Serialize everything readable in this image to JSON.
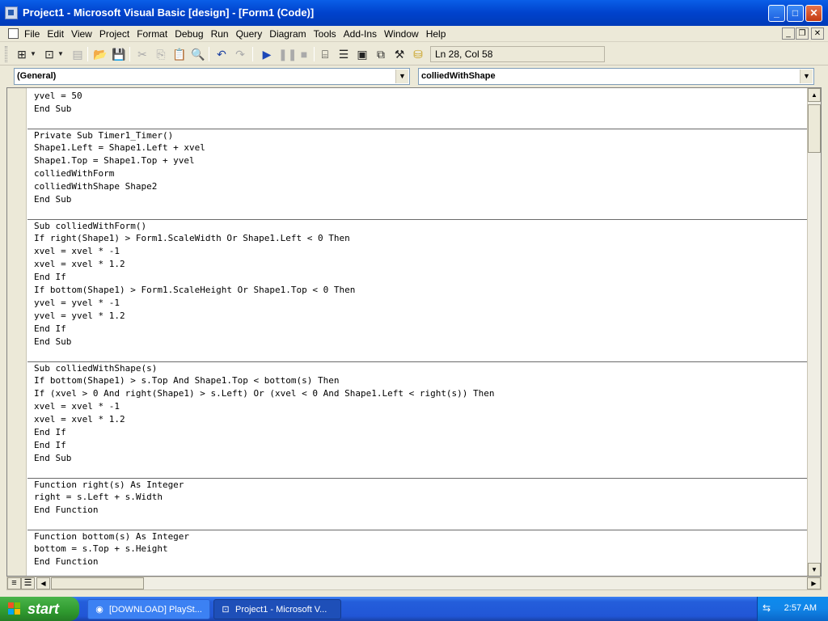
{
  "window": {
    "title": "Project1 - Microsoft Visual Basic [design] - [Form1 (Code)]",
    "buttons": {
      "minimize": "_",
      "maximize": "□",
      "close": "✕"
    }
  },
  "menu": [
    "File",
    "Edit",
    "View",
    "Project",
    "Format",
    "Debug",
    "Run",
    "Query",
    "Diagram",
    "Tools",
    "Add-Ins",
    "Window",
    "Help"
  ],
  "toolbar": {
    "position": "Ln 28, Col 58",
    "icons": [
      "add-project-icon",
      "add-form-icon",
      "menu-editor-icon",
      "open-icon",
      "save-icon",
      "cut-icon",
      "copy-icon",
      "paste-icon",
      "find-icon",
      "undo-icon",
      "redo-icon",
      "start-icon",
      "break-icon",
      "end-icon",
      "project-explorer-icon",
      "properties-icon",
      "form-layout-icon",
      "object-browser-icon",
      "toolbox-icon",
      "data-view-icon"
    ]
  },
  "combos": {
    "object": "(General)",
    "procedure": "colliedWithShape"
  },
  "code": [
    {
      "text": "yvel = 50",
      "sep": false
    },
    {
      "text": "End Sub",
      "sep": false
    },
    {
      "text": "",
      "sep": false
    },
    {
      "text": "Private Sub Timer1_Timer()",
      "sep": true
    },
    {
      "text": "Shape1.Left = Shape1.Left + xvel",
      "sep": false
    },
    {
      "text": "Shape1.Top = Shape1.Top + yvel",
      "sep": false
    },
    {
      "text": "colliedWithForm",
      "sep": false
    },
    {
      "text": "colliedWithShape Shape2",
      "sep": false
    },
    {
      "text": "End Sub",
      "sep": false
    },
    {
      "text": "",
      "sep": false
    },
    {
      "text": "Sub colliedWithForm()",
      "sep": true
    },
    {
      "text": "If right(Shape1) > Form1.ScaleWidth Or Shape1.Left < 0 Then",
      "sep": false
    },
    {
      "text": "xvel = xvel * -1",
      "sep": false
    },
    {
      "text": "xvel = xvel * 1.2",
      "sep": false
    },
    {
      "text": "End If",
      "sep": false
    },
    {
      "text": "If bottom(Shape1) > Form1.ScaleHeight Or Shape1.Top < 0 Then",
      "sep": false
    },
    {
      "text": "yvel = yvel * -1",
      "sep": false
    },
    {
      "text": "yvel = yvel * 1.2",
      "sep": false
    },
    {
      "text": "End If",
      "sep": false
    },
    {
      "text": "End Sub",
      "sep": false
    },
    {
      "text": "",
      "sep": false
    },
    {
      "text": "Sub colliedWithShape(s)",
      "sep": true
    },
    {
      "text": "If bottom(Shape1) > s.Top And Shape1.Top < bottom(s) Then",
      "sep": false
    },
    {
      "text": "If (xvel > 0 And right(Shape1) > s.Left) Or (xvel < 0 And Shape1.Left < right(s)) Then",
      "sep": false
    },
    {
      "text": "xvel = xvel * -1",
      "sep": false
    },
    {
      "text": "xvel = xvel * 1.2",
      "sep": false
    },
    {
      "text": "End If",
      "sep": false
    },
    {
      "text": "End If",
      "sep": false
    },
    {
      "text": "End Sub",
      "sep": false
    },
    {
      "text": "",
      "sep": false
    },
    {
      "text": "Function right(s) As Integer",
      "sep": true
    },
    {
      "text": "right = s.Left + s.Width",
      "sep": false
    },
    {
      "text": "End Function",
      "sep": false
    },
    {
      "text": "",
      "sep": false
    },
    {
      "text": "Function bottom(s) As Integer",
      "sep": true
    },
    {
      "text": "bottom = s.Top + s.Height",
      "sep": false
    },
    {
      "text": "End Function",
      "sep": false
    }
  ],
  "taskbar": {
    "start_label": "start",
    "tasks": [
      {
        "label": "[DOWNLOAD] PlaySt...",
        "active": false
      },
      {
        "label": "Project1 - Microsoft V...",
        "active": true
      }
    ],
    "clock": "2:57 AM"
  }
}
